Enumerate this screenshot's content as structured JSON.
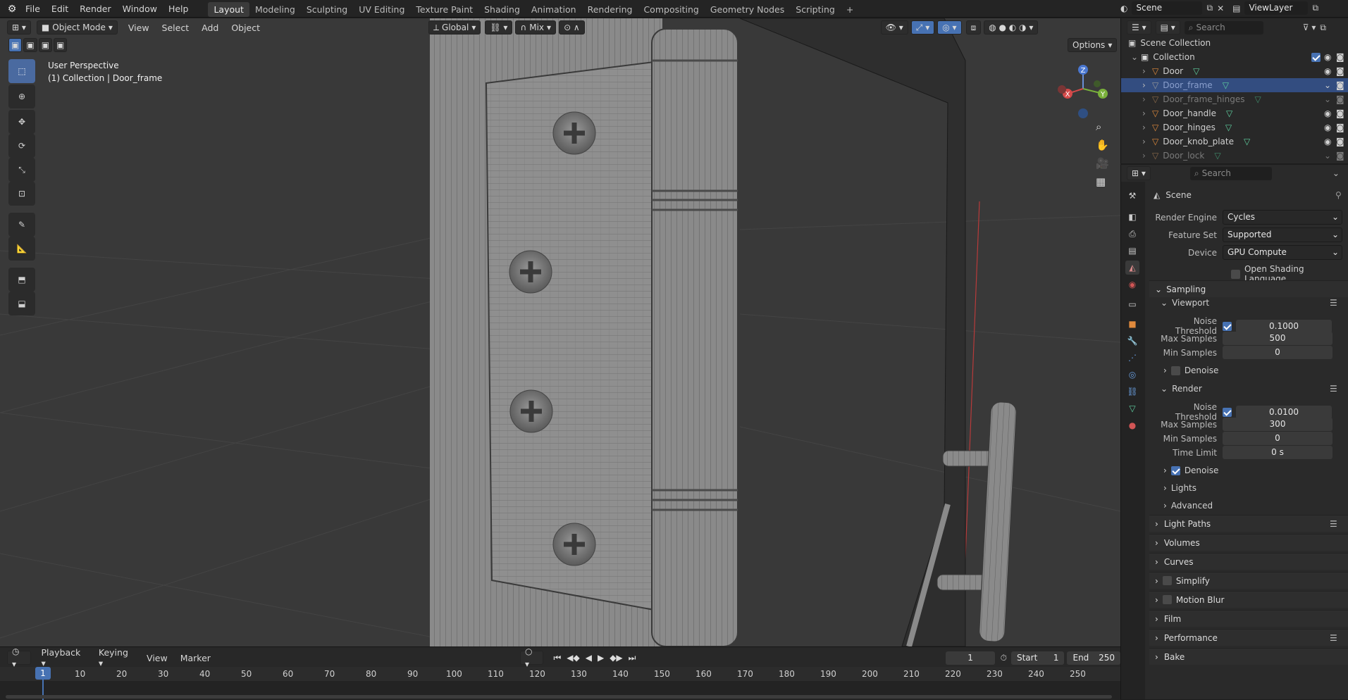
{
  "topbar": {
    "menus": [
      "File",
      "Edit",
      "Render",
      "Window",
      "Help"
    ],
    "workspaces": [
      "Layout",
      "Modeling",
      "Sculpting",
      "UV Editing",
      "Texture Paint",
      "Shading",
      "Animation",
      "Rendering",
      "Compositing",
      "Geometry Nodes",
      "Scripting"
    ],
    "active_workspace": "Layout",
    "add_tab": "+",
    "scene": "Scene",
    "viewlayer": "ViewLayer"
  },
  "viewport": {
    "mode": "Object Mode",
    "menus": [
      "View",
      "Select",
      "Add",
      "Object"
    ],
    "transform_orientation": "Global",
    "snap_mode": "Mix",
    "options": "Options",
    "info_line1": "User Perspective",
    "info_line2": "(1) Collection | Door_frame",
    "gizmo": {
      "x": "X",
      "y": "Y",
      "z": "Z"
    }
  },
  "timeline": {
    "menus": [
      "Playback",
      "Keying",
      "View",
      "Marker"
    ],
    "current_frame": "1",
    "start_label": "Start",
    "start": "1",
    "end_label": "End",
    "end": "250",
    "ticks": [
      "1",
      "10",
      "20",
      "30",
      "40",
      "50",
      "60",
      "70",
      "80",
      "90",
      "100",
      "110",
      "120",
      "130",
      "140",
      "150",
      "160",
      "170",
      "180",
      "190",
      "200",
      "210",
      "220",
      "230",
      "240",
      "250"
    ]
  },
  "outliner": {
    "search_placeholder": "Search",
    "scene_collection": "Scene Collection",
    "collection": "Collection",
    "items": [
      {
        "name": "Door",
        "selected": false,
        "dim": false
      },
      {
        "name": "Door_frame",
        "selected": true,
        "dim": false
      },
      {
        "name": "Door_frame_hinges",
        "selected": false,
        "dim": true
      },
      {
        "name": "Door_handle",
        "selected": false,
        "dim": false
      },
      {
        "name": "Door_hinges",
        "selected": false,
        "dim": false
      },
      {
        "name": "Door_knob_plate",
        "selected": false,
        "dim": false
      },
      {
        "name": "Door_lock",
        "selected": false,
        "dim": true
      }
    ]
  },
  "properties": {
    "search_placeholder": "Search",
    "context": "Scene",
    "render_engine_label": "Render Engine",
    "render_engine": "Cycles",
    "feature_set_label": "Feature Set",
    "feature_set": "Supported",
    "device_label": "Device",
    "device": "GPU Compute",
    "osl": "Open Shading Language",
    "sampling": "Sampling",
    "viewport": "Viewport",
    "noise_threshold_label": "Noise Threshold",
    "vp_noise_threshold": "0.1000",
    "max_samples_label": "Max Samples",
    "vp_max_samples": "500",
    "min_samples_label": "Min Samples",
    "vp_min_samples": "0",
    "denoise": "Denoise",
    "render": "Render",
    "r_noise_threshold": "0.0100",
    "r_max_samples": "300",
    "r_min_samples": "0",
    "time_limit_label": "Time Limit",
    "time_limit": "0 s",
    "lights": "Lights",
    "advanced": "Advanced",
    "panels": [
      "Light Paths",
      "Volumes",
      "Curves",
      "Simplify",
      "Motion Blur",
      "Film",
      "Performance",
      "Bake"
    ]
  },
  "colors": {
    "accent": "#4772b3",
    "selected_row": "#334d80",
    "viewport_bg": "#393939"
  }
}
